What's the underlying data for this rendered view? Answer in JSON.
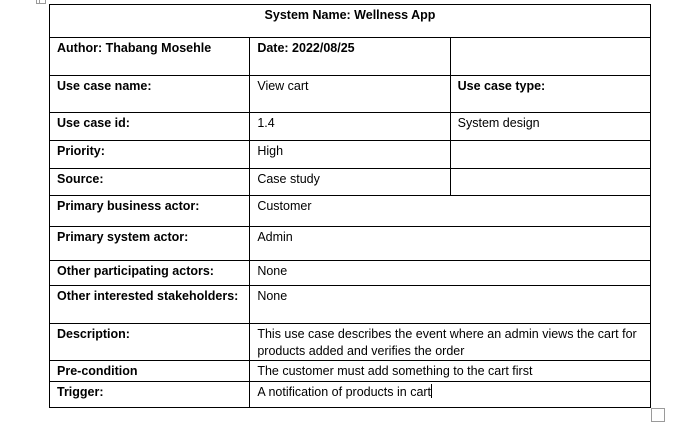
{
  "system_name": "System Name: Wellness App",
  "author": "Author: Thabang Mosehle",
  "date": "Date: 2022/08/25",
  "use_case_name_label": "Use case name:",
  "use_case_name_value": "View cart",
  "use_case_type_label": "Use case type:",
  "use_case_id_label": "Use case id:",
  "use_case_id_value": "1.4",
  "use_case_type_value": "System design",
  "priority_label": "Priority:",
  "priority_value": "High",
  "source_label": "Source:",
  "source_value": "Case study",
  "primary_business_actor_label": "Primary business actor:",
  "primary_business_actor_value": "Customer",
  "primary_system_actor_label": "Primary system actor:",
  "primary_system_actor_value": "Admin",
  "other_participating_actors_label": "Other participating actors:",
  "other_participating_actors_value": "None",
  "other_interested_stakeholders_label": "Other interested stakeholders:",
  "other_interested_stakeholders_value": "None",
  "description_label": "Description:",
  "description_value": "This use case describes the event where an admin views the cart for products added and verifies the order",
  "precondition_label": "Pre-condition",
  "precondition_value": "The customer must add something to the cart first",
  "trigger_label": "Trigger:",
  "trigger_value": "A notification of products in cart"
}
